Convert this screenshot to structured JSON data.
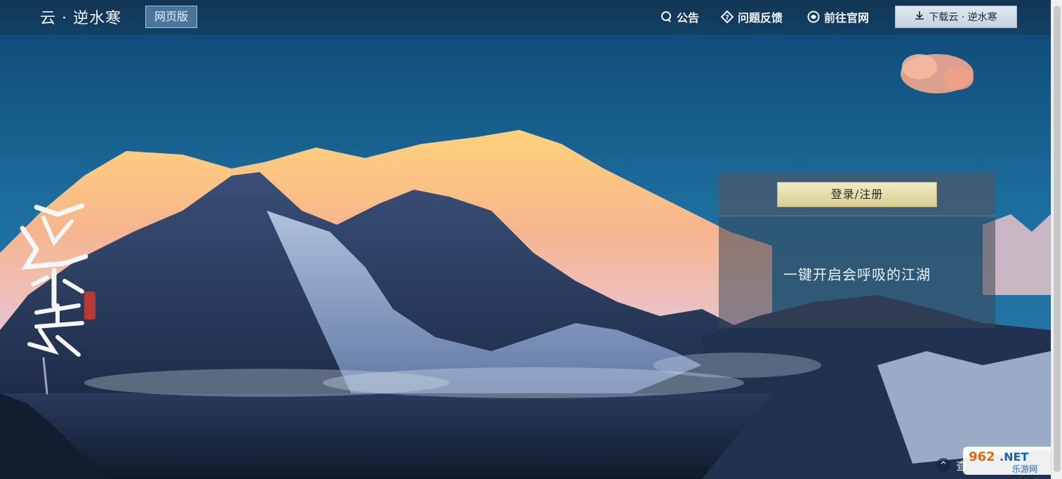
{
  "header": {
    "brand": "云 · 逆水寒",
    "tag": "网页版",
    "nav": [
      {
        "label": "公告",
        "icon": "notice-icon"
      },
      {
        "label": "问题反馈",
        "icon": "feedback-icon"
      },
      {
        "label": "前往官网",
        "icon": "website-icon"
      }
    ],
    "download_label": "下载云 · 逆水寒"
  },
  "login": {
    "button_label": "登录/注册",
    "slogan": "一键开启会呼吸的江湖"
  },
  "bottom": {
    "partial_text": "查",
    "up_arrow": "^"
  },
  "watermark": {
    "top": "962.NET",
    "bottom": "乐游网"
  },
  "colors": {
    "accent_gold": "#d9cf95",
    "nav_text": "#f2f4f6",
    "tag_bg": "#78a5d2"
  }
}
